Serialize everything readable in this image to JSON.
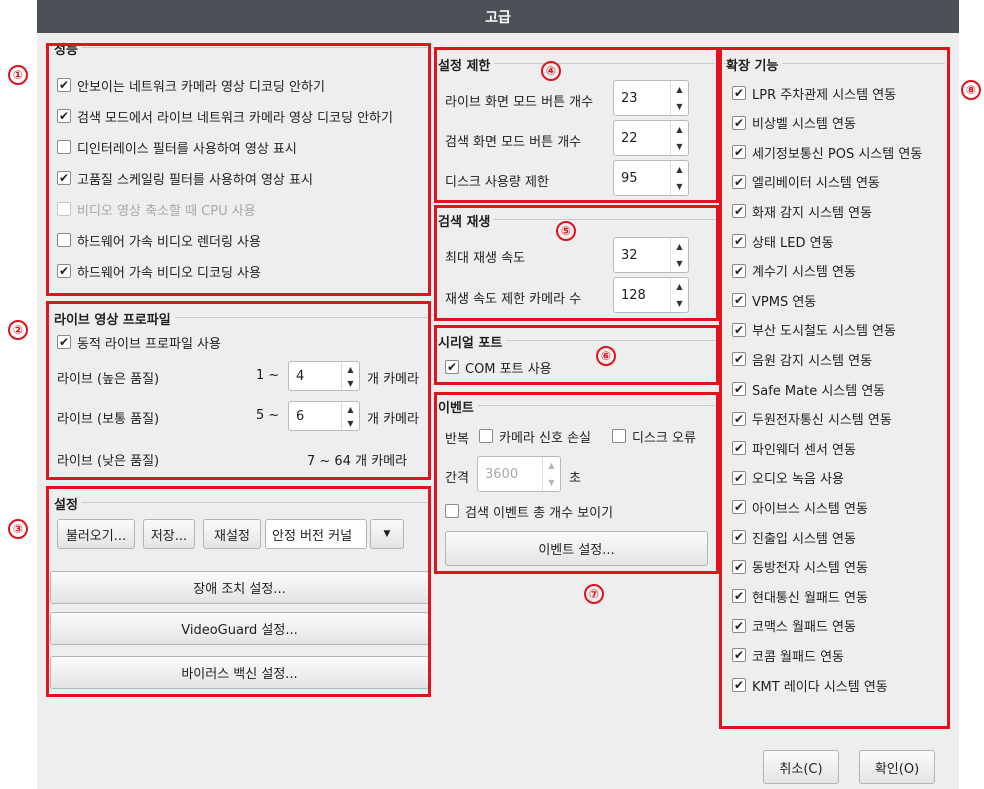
{
  "window": {
    "title": "고급"
  },
  "annotations": [
    "①",
    "②",
    "③",
    "④",
    "⑤",
    "⑥",
    "⑦",
    "⑧"
  ],
  "performance": {
    "title": "성능",
    "items": [
      {
        "label": "안보이는 네트워크 카메라 영상 디코딩 안하기",
        "checked": true,
        "enabled": true
      },
      {
        "label": "검색 모드에서 라이브 네트워크 카메라 영상 디코딩 안하기",
        "checked": true,
        "enabled": true
      },
      {
        "label": "디인터레이스 필터를 사용하여 영상 표시",
        "checked": false,
        "enabled": true
      },
      {
        "label": "고품질 스케일링 필터를 사용하여 영상 표시",
        "checked": true,
        "enabled": true
      },
      {
        "label": "비디오 영상 축소할 때 CPU 사용",
        "checked": false,
        "enabled": false
      },
      {
        "label": "하드웨어 가속 비디오 렌더링 사용",
        "checked": false,
        "enabled": true
      },
      {
        "label": "하드웨어 가속 비디오 디코딩 사용",
        "checked": true,
        "enabled": true
      }
    ]
  },
  "live_profile": {
    "title": "라이브 영상 프로파일",
    "dynamic_label": "동적 라이브 프로파일 사용",
    "high_label": "라이브 (높은 품질)",
    "high_range": "1 ~",
    "high_value": "4",
    "mid_label": "라이브 (보통 품질)",
    "mid_range": "5 ~",
    "mid_value": "6",
    "low_label": "라이브 (낮은 품질)",
    "low_range": "7 ~ 64 개 카메라",
    "unit": "개 카메라"
  },
  "settings": {
    "title": "설정",
    "load_label": "불러오기...",
    "save_label": "저장...",
    "reset_label": "재설정",
    "kernel_value": "안정 버전 커널",
    "failover_label": "장애 조치 설정...",
    "videoguard_label": "VideoGuard 설정...",
    "antivirus_label": "바이러스 백신 설정..."
  },
  "limits": {
    "title": "설정 제한",
    "live_buttons_label": "라이브 화면 모드 버튼 개수",
    "live_buttons_value": "23",
    "search_buttons_label": "검색 화면 모드 버튼 개수",
    "search_buttons_value": "22",
    "disk_label": "디스크 사용량 제한",
    "disk_value": "95"
  },
  "playback": {
    "title": "검색 재생",
    "max_speed_label": "최대 재생 속도",
    "max_speed_value": "32",
    "speed_limit_label": "재생 속도 제한 카메라 수",
    "speed_limit_value": "128"
  },
  "serial": {
    "title": "시리얼 포트",
    "com_label": "COM 포트 사용"
  },
  "event": {
    "title": "이벤트",
    "repeat_label": "반복",
    "signal_loss_label": "카메라 신호 손실",
    "disk_error_label": "디스크 오류",
    "interval_label": "간격",
    "interval_value": "3600",
    "interval_unit": "초",
    "show_count_label": "검색 이벤트 총 개수 보이기",
    "settings_label": "이벤트 설정..."
  },
  "extensions": {
    "title": "확장 기능",
    "items": [
      "LPR 주차관제 시스템 연동",
      "비상벨 시스템 연동",
      "세기정보통신 POS 시스템 연동",
      "엘리베이터 시스템 연동",
      "화재 감지 시스템 연동",
      "상태 LED 연동",
      "계수기 시스템 연동",
      "VPMS 연동",
      "부산 도시철도 시스템 연동",
      "음원 감지 시스템 연동",
      "Safe Mate 시스템 연동",
      "두원전자통신 시스템 연동",
      "파인웨더 센서 연동",
      "오디오 녹음 사용",
      "아이브스 시스템 연동",
      "진출입 시스템 연동",
      "동방전자 시스템 연동",
      "현대통신 월패드 연동",
      "코맥스 월패드 연동",
      "코콤 월패드 연동",
      "KMT 레이다 시스템 연동"
    ]
  },
  "footer": {
    "cancel_label": "취소(C)",
    "ok_label": "확인(O)"
  },
  "icons": {
    "check": "checkmark-icon",
    "spin_up": "spin-up-icon",
    "spin_down": "spin-down-icon",
    "dropdown": "dropdown-arrow-icon"
  },
  "colors": {
    "titlebar": "#4d5157",
    "annotation": "#e0141e",
    "dialog_bg": "#eeeeee"
  }
}
